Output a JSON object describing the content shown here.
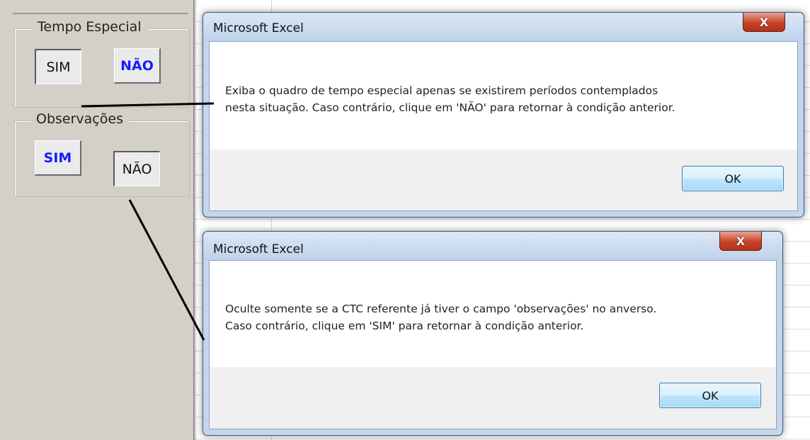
{
  "panel": {
    "groups": [
      {
        "legend": "Tempo Especial",
        "buttons": [
          {
            "label": "SIM",
            "state": "pressed",
            "bold": false
          },
          {
            "label": "NÃO",
            "state": "raised",
            "bold": true
          }
        ]
      },
      {
        "legend": "Observações",
        "buttons": [
          {
            "label": "SIM",
            "state": "raised",
            "bold": true
          },
          {
            "label": "NÃO",
            "state": "pressed",
            "bold": false
          }
        ]
      }
    ]
  },
  "dialogs": [
    {
      "title": "Microsoft Excel",
      "close": "X",
      "message_line1": "Exiba o quadro de tempo especial apenas se existirem períodos contemplados",
      "message_line2": "nesta situação. Caso contrário, clique em 'NÃO' para retornar à condição anterior.",
      "ok": "OK"
    },
    {
      "title": "Microsoft Excel",
      "close": "X",
      "message_line1": "Oculte somente se a CTC referente já tiver o campo 'observações' no anverso.",
      "message_line2": "Caso contrário, clique em 'SIM' para retornar à condição anterior.",
      "ok": "OK"
    }
  ],
  "colors": {
    "bold_label": "#1a1aff",
    "panel_bg": "#d4d0c8",
    "dialog_frame": "#c4d6ec",
    "close_button": "#c7432a"
  }
}
